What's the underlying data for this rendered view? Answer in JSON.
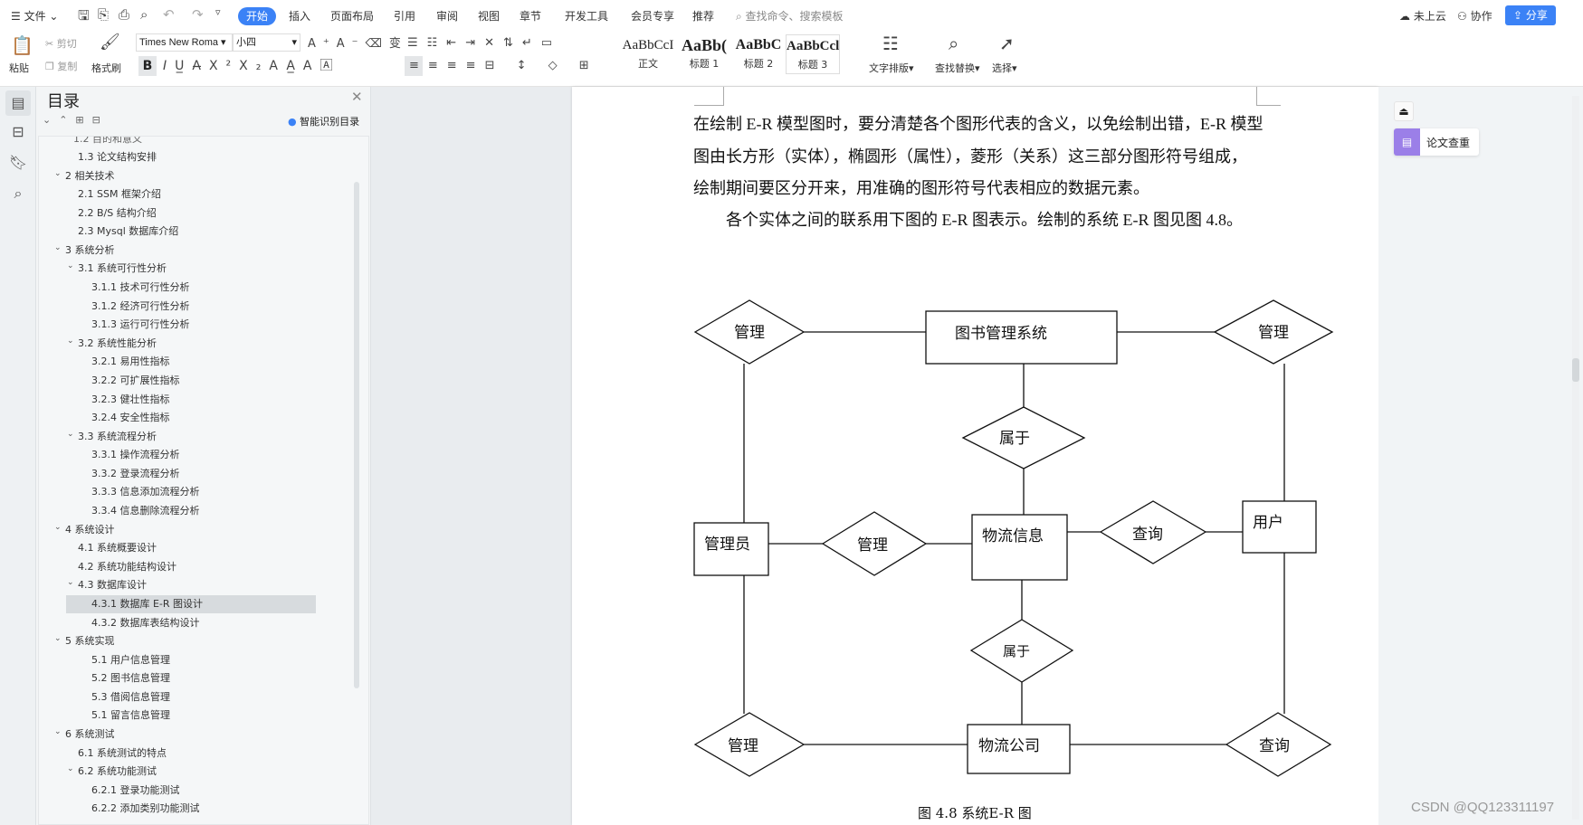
{
  "titlebar": {
    "file_menu": "文件",
    "tabs": [
      "开始",
      "插入",
      "页面布局",
      "引用",
      "审阅",
      "视图",
      "章节",
      "开发工具",
      "会员专享",
      "推荐"
    ],
    "active_tab": "开始",
    "search_placeholder": "查找命令、搜索模板",
    "cloud": "未上云",
    "collab": "协作",
    "share": "分享"
  },
  "ribbon": {
    "paste": "粘贴",
    "cut": "剪切",
    "copy": "复制",
    "format_painter": "格式刷",
    "font_name": "Times New Roma",
    "font_size": "小四",
    "styles": [
      {
        "sample": "AaBbCcI",
        "label": "正文"
      },
      {
        "sample": "AaBb(",
        "label": "标题 1"
      },
      {
        "sample": "AaBbC",
        "label": "标题 2"
      },
      {
        "sample": "AaBbCcl",
        "label": "标题 3"
      }
    ],
    "text_layout": "文字排版",
    "find_replace": "查找替换",
    "select": "选择"
  },
  "toc": {
    "title": "目录",
    "smart_toc": "智能识别目录",
    "items": [
      {
        "text": "1.3  论文结构安排",
        "level": 2,
        "arrow": false
      },
      {
        "text": "2  相关技术",
        "level": 1,
        "arrow": true
      },
      {
        "text": "2.1 SSM 框架介绍",
        "level": 2,
        "arrow": false
      },
      {
        "text": "2.2 B/S 结构介绍",
        "level": 2,
        "arrow": false
      },
      {
        "text": "2.3 Mysql 数据库介绍",
        "level": 2,
        "arrow": false
      },
      {
        "text": "3  系统分析",
        "level": 1,
        "arrow": true
      },
      {
        "text": "3.1  系统可行性分析",
        "level": 2,
        "arrow": true
      },
      {
        "text": "3.1.1  技术可行性分析",
        "level": 3,
        "arrow": false
      },
      {
        "text": "3.1.2  经济可行性分析",
        "level": 3,
        "arrow": false
      },
      {
        "text": "3.1.3  运行可行性分析",
        "level": 3,
        "arrow": false
      },
      {
        "text": "3.2  系统性能分析",
        "level": 2,
        "arrow": true
      },
      {
        "text": "3.2.1  易用性指标",
        "level": 3,
        "arrow": false
      },
      {
        "text": "3.2.2  可扩展性指标",
        "level": 3,
        "arrow": false
      },
      {
        "text": "3.2.3  健壮性指标",
        "level": 3,
        "arrow": false
      },
      {
        "text": "3.2.4  安全性指标",
        "level": 3,
        "arrow": false
      },
      {
        "text": "3.3  系统流程分析",
        "level": 2,
        "arrow": true
      },
      {
        "text": "3.3.1  操作流程分析",
        "level": 3,
        "arrow": false
      },
      {
        "text": "3.3.2  登录流程分析",
        "level": 3,
        "arrow": false
      },
      {
        "text": "3.3.3  信息添加流程分析",
        "level": 3,
        "arrow": false
      },
      {
        "text": "3.3.4  信息删除流程分析",
        "level": 3,
        "arrow": false
      },
      {
        "text": "4  系统设计",
        "level": 1,
        "arrow": true
      },
      {
        "text": "4.1  系统概要设计",
        "level": 2,
        "arrow": false
      },
      {
        "text": "4.2  系统功能结构设计",
        "level": 2,
        "arrow": false
      },
      {
        "text": "4.3  数据库设计",
        "level": 2,
        "arrow": true
      },
      {
        "text": "4.3.1  数据库 E-R 图设计",
        "level": 3,
        "arrow": false,
        "selected": true
      },
      {
        "text": "4.3.2  数据库表结构设计",
        "level": 3,
        "arrow": false
      },
      {
        "text": "5  系统实现",
        "level": 1,
        "arrow": true
      },
      {
        "text": "5.1 用户信息管理",
        "level": 3,
        "arrow": false
      },
      {
        "text": "5.2  图书信息管理",
        "level": 3,
        "arrow": false
      },
      {
        "text": "5.3 借阅信息管理",
        "level": 3,
        "arrow": false
      },
      {
        "text": "5.1 留言信息管理",
        "level": 3,
        "arrow": false
      },
      {
        "text": "6  系统测试",
        "level": 1,
        "arrow": true
      },
      {
        "text": "6.1  系统测试的特点",
        "level": 2,
        "arrow": false
      },
      {
        "text": "6.2  系统功能测试",
        "level": 2,
        "arrow": true
      },
      {
        "text": "6.2.1  登录功能测试",
        "level": 3,
        "arrow": false
      },
      {
        "text": "6.2.2  添加类别功能测试",
        "level": 3,
        "arrow": false
      }
    ]
  },
  "document": {
    "paragraphs": [
      "在绘制 E-R 模型图时，要分清楚各个图形代表的含义，以免绘制出错，E-R 模型",
      "图由长方形（实体），椭圆形（属性），菱形（关系）这三部分图形符号组成，",
      "绘制期间要区分开来，用准确的图形符号代表相应的数据元素。",
      "各个实体之间的联系用下图的 E-R 图表示。绘制的系统 E-R 图见图 4.8。"
    ],
    "figure_caption": "图 4.8  系统E-R 图",
    "er": {
      "entities": [
        "图书管理系统",
        "管理员",
        "物流信息",
        "用户",
        "物流公司"
      ],
      "relations": [
        "管理",
        "管理",
        "属于",
        "管理",
        "查询",
        "属于",
        "管理",
        "查询"
      ]
    }
  },
  "rightpanel": {
    "plagiarism_check": "论文查重"
  },
  "watermark": "CSDN @QQ123311197",
  "colors": {
    "accent": "#3b82f6",
    "purple": "#9b7fe8"
  }
}
